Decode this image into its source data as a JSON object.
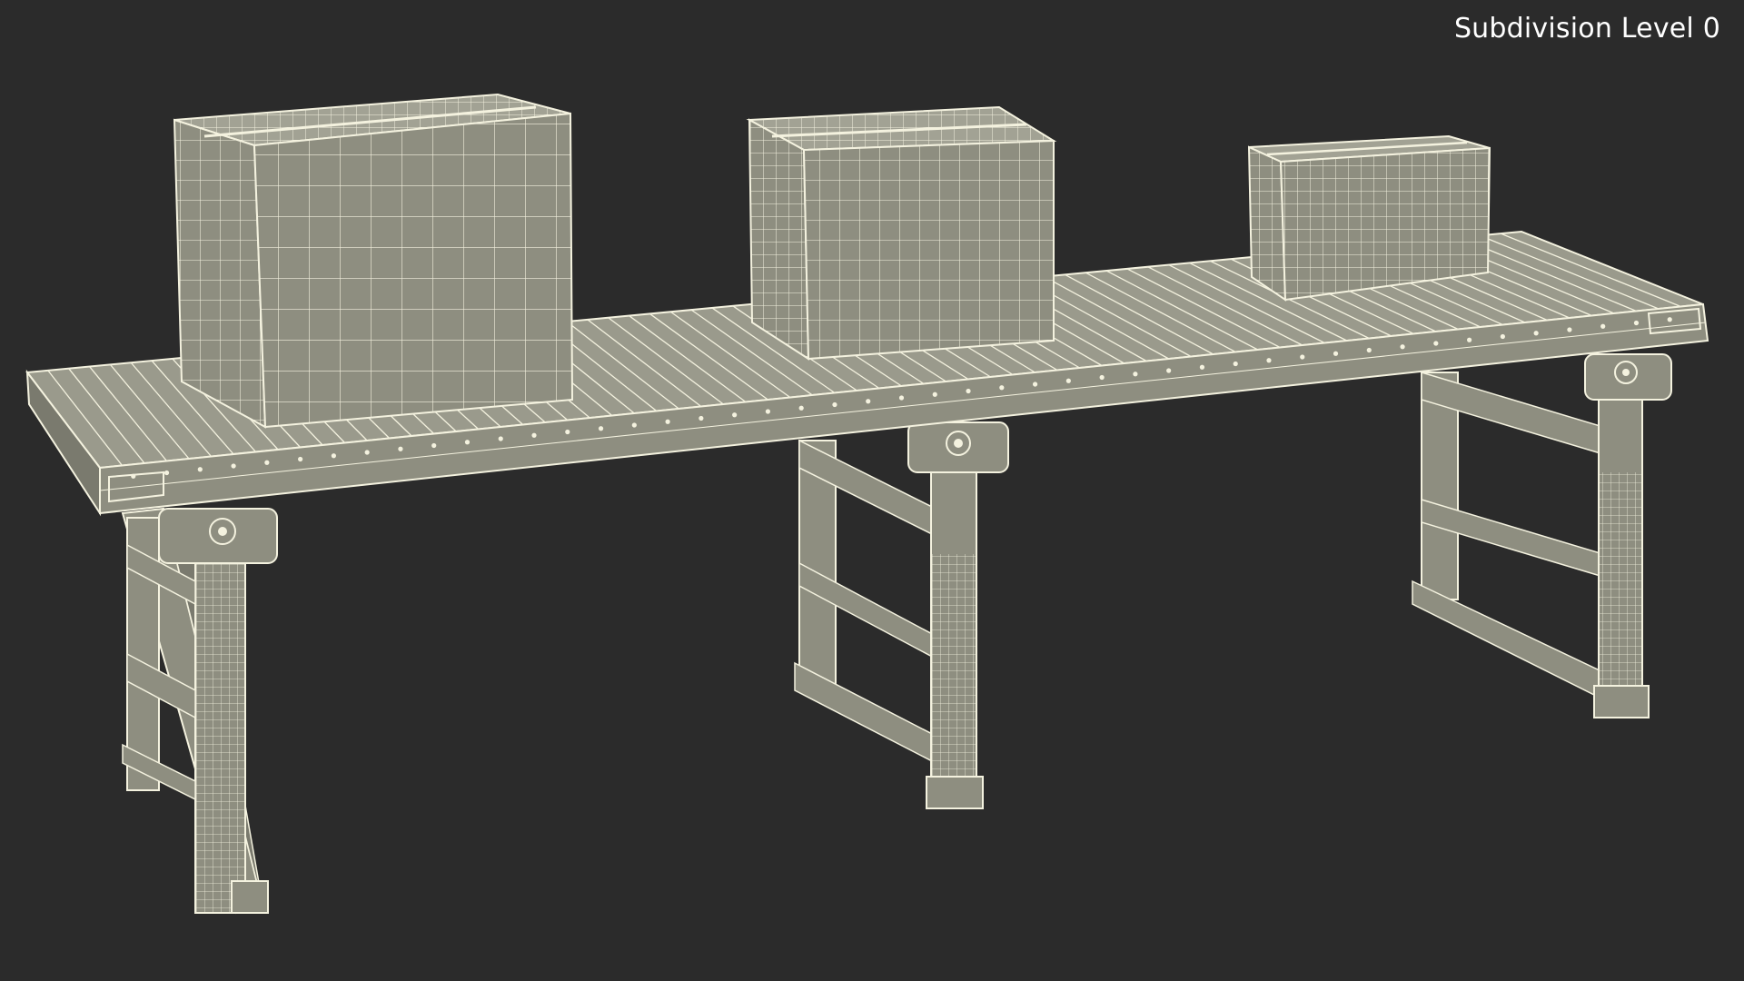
{
  "overlay": {
    "subdivision_label": "Subdivision Level 0"
  },
  "colors": {
    "background": "#2b2b2b",
    "fill": "#8e8e80",
    "fill_dark": "#6e6e62",
    "fill_light": "#a2a294",
    "wire": "#f4f2df"
  }
}
